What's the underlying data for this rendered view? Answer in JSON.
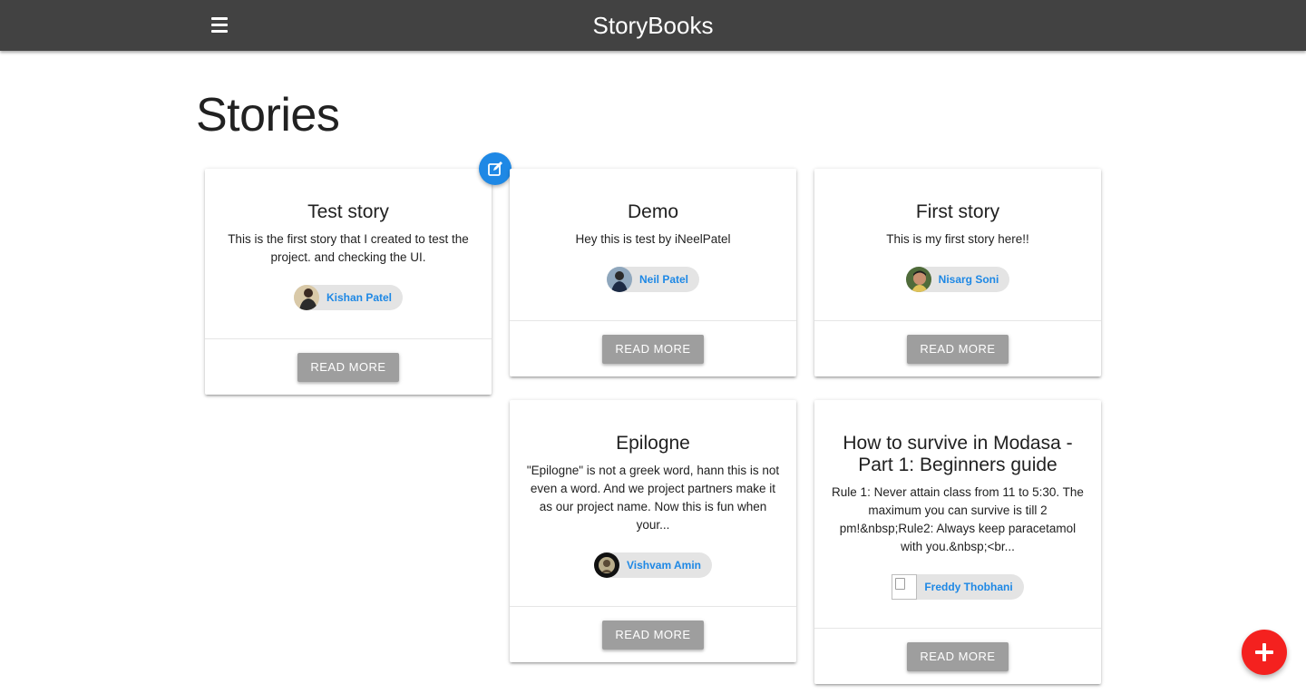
{
  "header": {
    "brand": "StoryBooks",
    "menu_icon": "hamburger-menu-icon",
    "background": "#424242"
  },
  "page": {
    "title": "Stories"
  },
  "stories": [
    {
      "title": "Test story",
      "body": "This is the first story that I created to test the project. and checking the UI.",
      "author": "Kishan Patel",
      "read_more": "Read More",
      "editable": true,
      "edit_icon": "edit-icon"
    },
    {
      "title": "Demo",
      "body": "Hey this is test by iNeelPatel",
      "author": "Neil Patel",
      "read_more": "Read More"
    },
    {
      "title": "First story",
      "body": "This is my first story here!!",
      "author": "Nisarg Soni",
      "read_more": "Read More"
    },
    {
      "title": "Epilogne",
      "body": "\"Epilogne\" is not a greek word, hann this is not even a word. And we project partners make it as our project name. Now this is fun when your...",
      "author": "Vishvam Amin",
      "read_more": "Read More"
    },
    {
      "title": "How to survive in Modasa - Part 1: Beginners guide",
      "body": "Rule 1: Never attain class from 11 to 5:30. The maximum you can survive is till 2 pm!&nbsp;Rule2: Always keep paracetamol with you.&nbsp;<br...",
      "author": "Freddy Thobhani",
      "read_more": "Read More",
      "avatar_broken": true
    }
  ],
  "add_button_icon": "plus-icon",
  "colors": {
    "accent_blue": "#1e88e5",
    "fab_red": "#f4211f",
    "button_grey": "#9e9e9e",
    "chip_bg": "#e4e4e4"
  }
}
